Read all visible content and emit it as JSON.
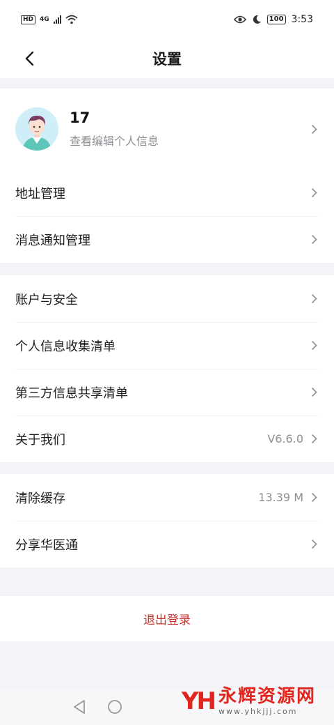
{
  "status_bar": {
    "hd": "HD",
    "network": "4G",
    "time": "3:53",
    "battery": "100"
  },
  "header": {
    "title": "设置"
  },
  "profile": {
    "name": "17",
    "subtitle": "查看编辑个人信息"
  },
  "section1": {
    "items": [
      {
        "label": "地址管理"
      },
      {
        "label": "消息通知管理"
      }
    ]
  },
  "section2": {
    "items": [
      {
        "label": "账户与安全"
      },
      {
        "label": "个人信息收集清单"
      },
      {
        "label": "第三方信息共享清单"
      },
      {
        "label": "关于我们",
        "value": "V6.6.0"
      }
    ]
  },
  "section3": {
    "items": [
      {
        "label": "清除缓存",
        "value": "13.39 M"
      },
      {
        "label": "分享华医通"
      }
    ]
  },
  "logout_label": "退出登录",
  "watermark": {
    "logo": "YH",
    "name": "永辉资源网",
    "url": "www.yhkjjj.com"
  },
  "colors": {
    "accent_red": "#c8322b",
    "background": "#f3f4f8",
    "card": "#ffffff"
  }
}
